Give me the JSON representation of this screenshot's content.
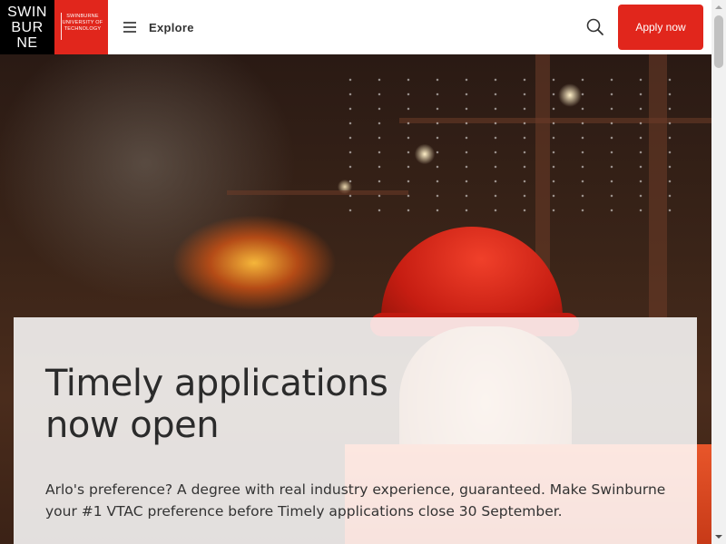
{
  "header": {
    "logo": {
      "line1": "SWIN",
      "line2": "BUR",
      "line3": "NE",
      "tagline": "SWINBURNE UNIVERSITY OF TECHNOLOGY"
    },
    "menu": {
      "label": "Explore",
      "icon": "hamburger-icon"
    },
    "search": {
      "icon": "search-icon"
    },
    "apply_label": "Apply now"
  },
  "hero": {
    "title": "Timely applications now open",
    "body": "Arlo's preference? A degree with real industry experience, guaranteed. Make Swinburne your #1 VTAC preference before Timely applications close 30 September."
  },
  "colors": {
    "brand_red": "#e1261c",
    "logo_black": "#000000"
  }
}
